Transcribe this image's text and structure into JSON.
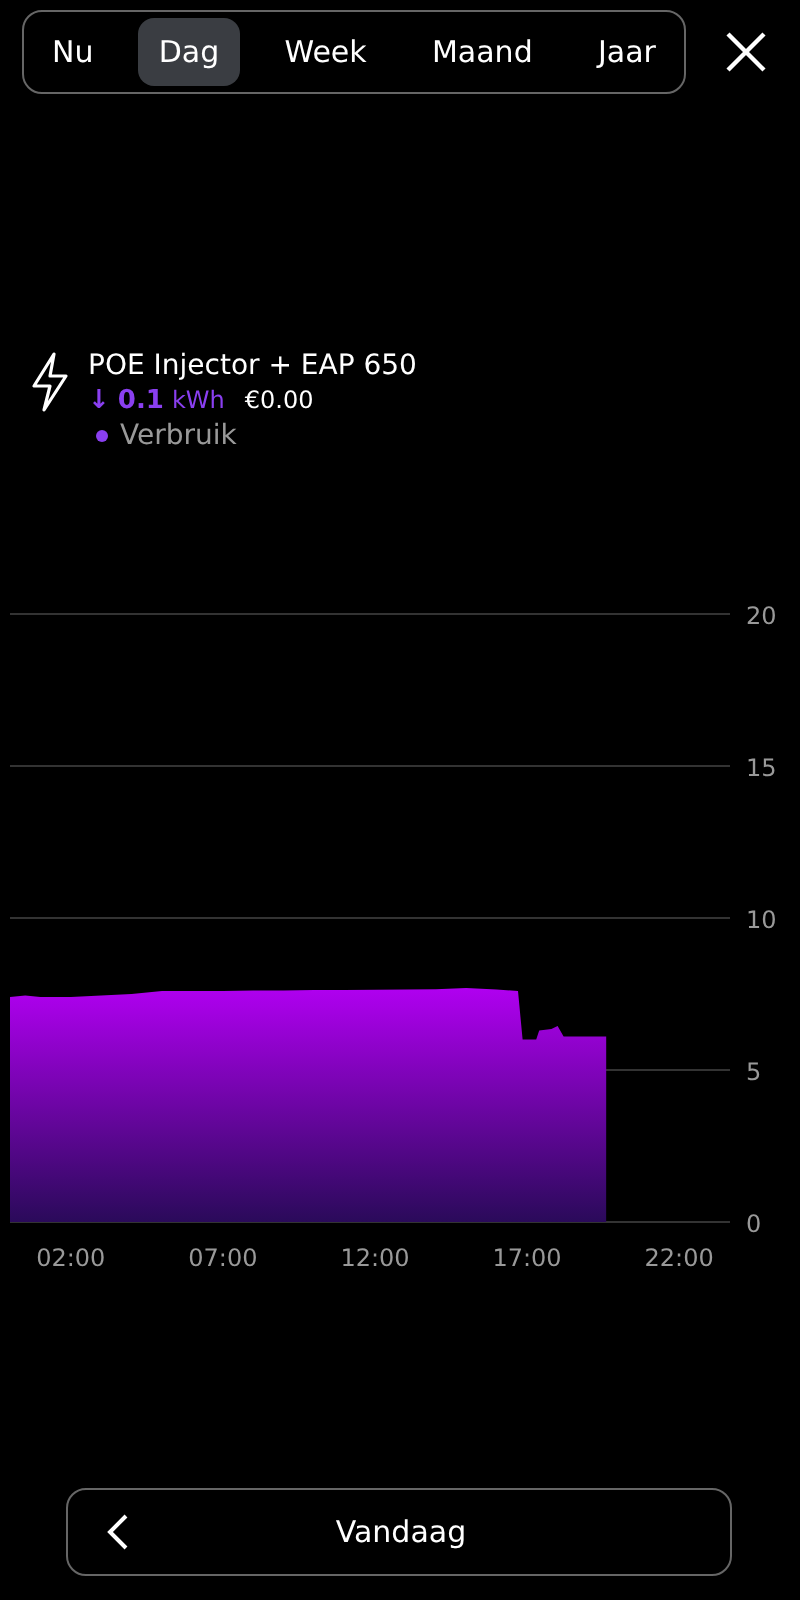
{
  "tabs": [
    {
      "label": "Nu",
      "selected": false
    },
    {
      "label": "Dag",
      "selected": true
    },
    {
      "label": "Week",
      "selected": false
    },
    {
      "label": "Maand",
      "selected": false
    },
    {
      "label": "Jaar",
      "selected": false
    }
  ],
  "device": {
    "name": "POE Injector  + EAP 650",
    "arrow": "↓",
    "amount": "0.1",
    "unit": "kWh",
    "cost": "€0.00",
    "legend": {
      "color": "#8a3ff0"
    }
  },
  "chart_data": {
    "type": "area",
    "x": [
      0,
      0.5,
      1,
      2,
      3,
      4,
      5,
      6,
      7,
      8,
      9,
      10,
      11,
      12,
      13,
      14,
      15,
      16,
      16.7,
      16.85,
      17.3,
      17.4,
      17.8,
      18,
      18.2,
      19,
      19.6
    ],
    "series": [
      {
        "name": "Verbruik",
        "color": "#b000f0",
        "values": [
          7.4,
          7.45,
          7.4,
          7.4,
          7.45,
          7.5,
          7.6,
          7.6,
          7.6,
          7.62,
          7.62,
          7.63,
          7.63,
          7.64,
          7.65,
          7.66,
          7.7,
          7.65,
          7.6,
          6,
          6,
          6.3,
          6.35,
          6.45,
          6.1,
          6.1,
          6.1
        ]
      }
    ],
    "grid": true,
    "xlim": [
      0,
      24
    ],
    "ylim": [
      0,
      20
    ],
    "xticks": [
      {
        "value": 2,
        "label": "02:00"
      },
      {
        "value": 7,
        "label": "07:00"
      },
      {
        "value": 12,
        "label": "12:00"
      },
      {
        "value": 17,
        "label": "17:00"
      },
      {
        "value": 22,
        "label": "22:00"
      }
    ],
    "yticks": [
      0,
      5,
      10,
      15,
      20
    ]
  },
  "footer": {
    "label": "Vandaag"
  }
}
